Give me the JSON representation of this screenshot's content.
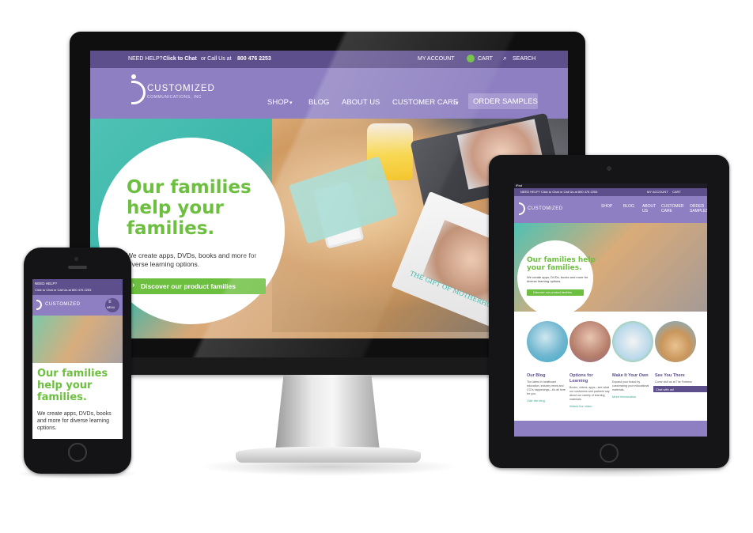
{
  "desktop": {
    "topbar": {
      "need_help": "NEED HELP?",
      "click_to_chat": "Click to Chat",
      "call_us": "or Call Us at",
      "phone": "800 476 2253",
      "my_account": "MY ACCOUNT",
      "cart": "CART",
      "search": "SEARCH"
    },
    "logo": {
      "name": "CUSTOMIZED",
      "sub": "COMMUNICATIONS, INC"
    },
    "nav": {
      "shop": "SHOP",
      "blog": "BLOG",
      "about_us": "ABOUT US",
      "customer_care": "CUSTOMER CARE",
      "order_samples": "ORDER SAMPLES"
    },
    "hero": {
      "title": "Our families help your families.",
      "subtitle": "We create apps, DVDs, books and more for diverse learning options.",
      "cta": "Discover our product families",
      "book_title": "THE GIFT OF MOTHERHOOD"
    }
  },
  "phone": {
    "need_help": "NEED HELP?",
    "contact": "Click to Chat or Call Us at 800 476 2253",
    "logo": "CUSTOMIZED",
    "menu": "MENU",
    "title": "Our families help your families.",
    "subtitle": "We create apps, DVDs, books and more for diverse learning options."
  },
  "tablet": {
    "status": "iPad",
    "contact": "NEED HELP? Click to Chat or Call Us at 800 476 2253",
    "my_account": "MY ACCOUNT",
    "cart": "CART",
    "logo": "CUSTOMIZED",
    "nav": {
      "shop": "SHOP",
      "blog": "BLOG",
      "about": "ABOUT US",
      "customer_care": "CUSTOMER CARE",
      "order": "ORDER SAMPLES"
    },
    "hero": {
      "title": "Our families help your families.",
      "subtitle": "We create apps, DVDs, books and more for diverse learning options.",
      "cta": "Discover our product families"
    },
    "columns": [
      {
        "heading": "Our Blog",
        "text": "The latest in healthcare education, industry news and CCI's happenings—it's all here for you.",
        "link": "Visit the blog"
      },
      {
        "heading": "Options for Learning",
        "text": "Books, videos, apps—see what our customers and partners say about our variety of learning materials.",
        "link": "Watch the video"
      },
      {
        "heading": "Make It Your Own",
        "text": "Expand your brand by customizing your educational materials.",
        "link": "More information"
      },
      {
        "heading": "See You There",
        "text": "Come visit us at The Fortress",
        "link": "Learn more"
      }
    ],
    "chat": "Chat with us!"
  },
  "colors": {
    "purple_dark": "#5d4f8c",
    "purple": "#8d7fc1",
    "green": "#6cbf3f",
    "teal": "#3ab6aa"
  }
}
